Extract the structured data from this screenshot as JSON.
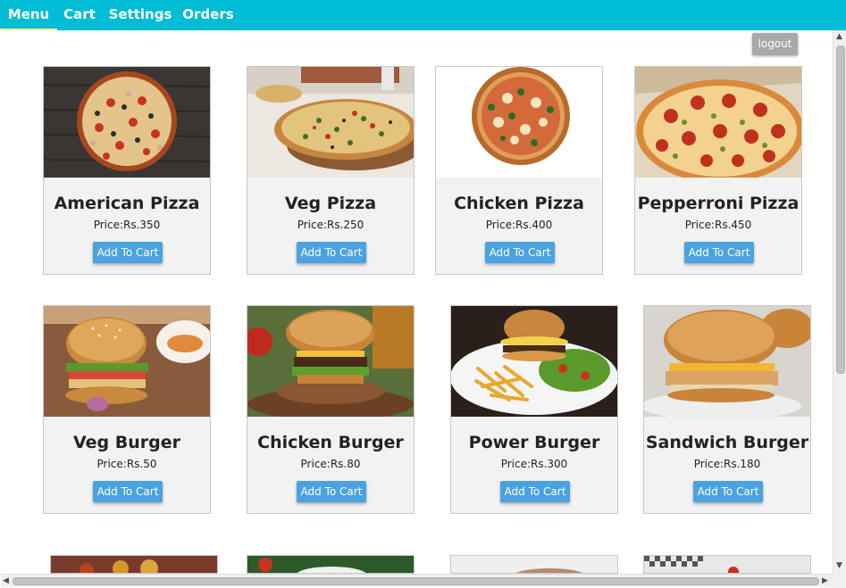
{
  "nav": {
    "tabs": [
      "Menu",
      "Cart",
      "Settings",
      "Orders"
    ],
    "active": "Menu"
  },
  "logout_label": "logout",
  "products": [
    {
      "name": "American Pizza",
      "price": "Price:Rs.350",
      "button": "Add To Cart",
      "icon": "american-pizza-image"
    },
    {
      "name": "Veg Pizza",
      "price": "Price:Rs.250",
      "button": "Add To Cart",
      "icon": "veg-pizza-image"
    },
    {
      "name": "Chicken Pizza",
      "price": "Price:Rs.400",
      "button": "Add To Cart",
      "icon": "chicken-pizza-image"
    },
    {
      "name": "Pepperroni Pizza",
      "price": "Price:Rs.450",
      "button": "Add To Cart",
      "icon": "pepperoni-pizza-image"
    },
    {
      "name": "Veg Burger",
      "price": "Price:Rs.50",
      "button": "Add To Cart",
      "icon": "veg-burger-image"
    },
    {
      "name": "Chicken Burger",
      "price": "Price:Rs.80",
      "button": "Add To Cart",
      "icon": "chicken-burger-image"
    },
    {
      "name": "Power Burger",
      "price": "Price:Rs.300",
      "button": "Add To Cart",
      "icon": "power-burger-image"
    },
    {
      "name": "Sandwich Burger",
      "price": "Price:Rs.180",
      "button": "Add To Cart",
      "icon": "sandwich-burger-image"
    }
  ],
  "colors": {
    "nav_bar": "#00bcd4",
    "active_tab_underline": "#fff3a0",
    "add_to_cart_button": "#4aa3df",
    "logout_button": "#a8a8a8",
    "card_background": "#f2f2f2"
  }
}
